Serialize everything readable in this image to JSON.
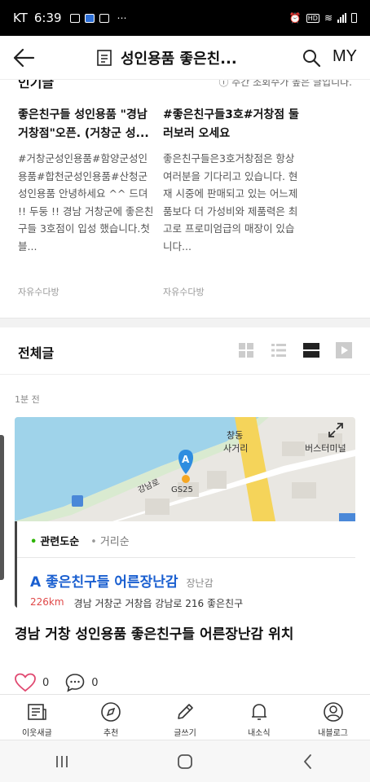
{
  "status": {
    "carrier": "KT",
    "time": "6:39",
    "more": "⋯"
  },
  "header": {
    "title": "성인용품 좋은친...",
    "right_label": "MY"
  },
  "popular": {
    "heading": "인기글",
    "note": "ⓘ 주간 조회수가 높은 글입니다.",
    "cards": [
      {
        "title": "좋은친구들 성인용품 \"경남 거창점\"오픈. (거창군 성...",
        "body": "#거창군성인용품#함양군성인용품#합천군성인용품#산청군성인용품 안녕하세요 ^^ 드뎌 !! 두둥 !! 경남 거창군에 좋은친구들 3호점이 입성 했습니다.첫 블...",
        "category": "자유수다방"
      },
      {
        "title": "#좋은친구들3호#거창점 둘러보러 오세요",
        "body": "좋은친구들은3호거창점은 항상 여러분을 기다리고 있습니다. 현재 시중에 판매되고 있는 어느제품보다 더 가성비와 제품력은 최고로 프로미엄급의 매장이 있습니다...",
        "category": "자유수다방"
      }
    ]
  },
  "all_posts": {
    "heading": "전체글"
  },
  "post": {
    "time_ago": "1분 전",
    "map": {
      "labels": [
        "창동",
        "사거리",
        "버스터미널",
        "강남로",
        "GS25"
      ],
      "pin_letter": "A"
    },
    "sort": {
      "active": "관련도순",
      "inactive": "거리순"
    },
    "place": {
      "letter": "A",
      "name": "좋은친구들 어른장난감",
      "category": "장난감",
      "distance": "226km",
      "address": "경남 거창군 거창읍 강남로 216 좋은친구"
    },
    "title": "경남 거창 성인용품 좋은친구들 어른장난감 위치",
    "likes": "0",
    "comments": "0"
  },
  "tabs": [
    {
      "label": "이웃새글",
      "icon": "feed-icon"
    },
    {
      "label": "추천",
      "icon": "compass-icon"
    },
    {
      "label": "글쓰기",
      "icon": "pencil-icon"
    },
    {
      "label": "내소식",
      "icon": "bell-icon"
    },
    {
      "label": "내블로그",
      "icon": "profile-icon"
    }
  ],
  "colors": {
    "accent_green": "#2db400",
    "place_blue": "#1a5fd0",
    "distance_red": "#e04848",
    "map_water": "#9fd3ea",
    "map_road": "#f5d45a"
  }
}
